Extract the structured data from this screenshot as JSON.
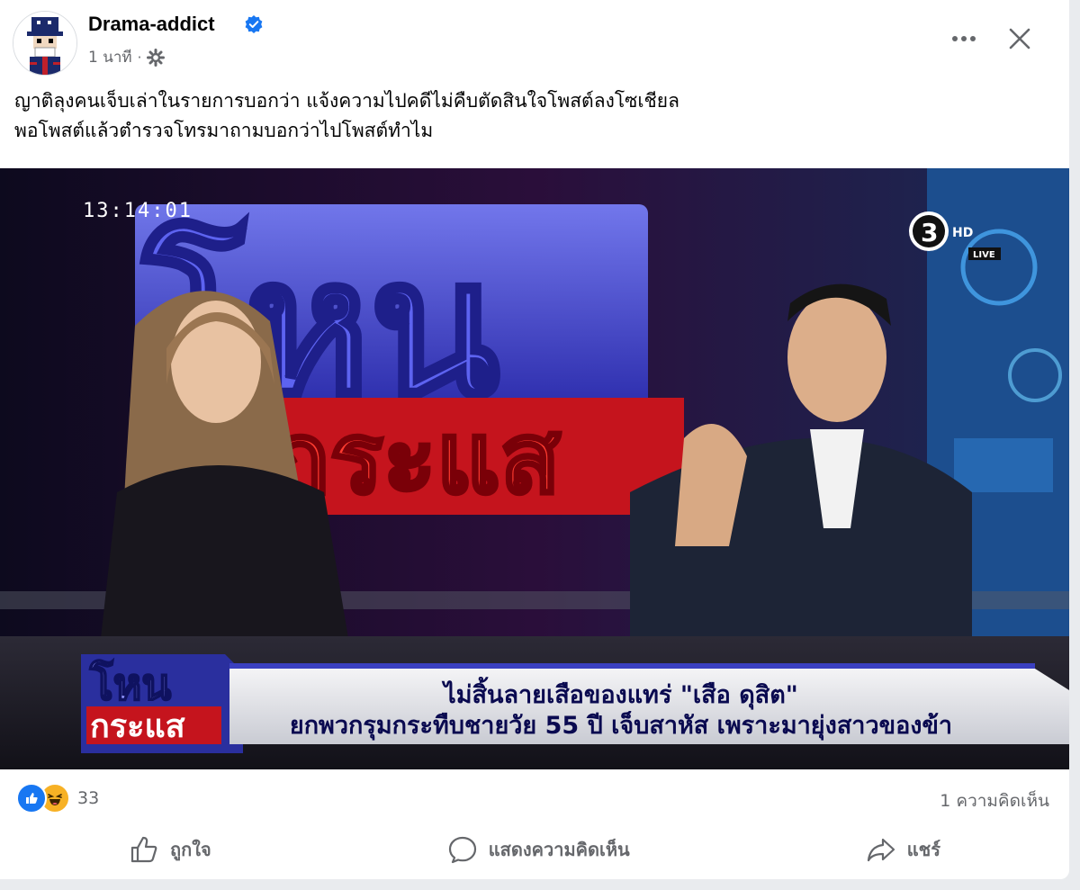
{
  "post": {
    "author": "Drama-addict",
    "time": "1 นาที",
    "caption_line1": "ญาติลุงคนเจ็บเล่าในรายการบอกว่า แจ้งความไปคดีไม่คืบตัดสินใจโพสต์ลงโซเชียล",
    "caption_line2": "พอโพสต์แล้วตำรวจโทรมาถามบอกว่าไปโพสต์ทำไม"
  },
  "media": {
    "timestamp": "13:14:01",
    "channel_number": "3",
    "channel_sub": "HD",
    "live_label": "LIVE",
    "show_logo_top": "โหน",
    "show_logo_bottom": "กระแส",
    "headline1": "ไม่สิ้นลายเสือของแทร่ \"เสือ ดุสิต\"",
    "headline2": "ยกพวกรุมกระทืบชายวัย 55 ปี เจ็บสาหัส เพราะมายุ่งสาวของข้า"
  },
  "stats": {
    "reaction_count": "33",
    "comment_count": "1 ความคิดเห็น"
  },
  "actions": {
    "like": "ถูกใจ",
    "comment": "แสดงความคิดเห็น",
    "share": "แชร์"
  },
  "icons": [
    "verified-badge-icon",
    "globe-icon",
    "more-options-icon",
    "close-icon",
    "like-reaction-icon",
    "haha-reaction-icon",
    "thumbs-up-icon",
    "comment-bubble-icon",
    "share-arrow-icon"
  ],
  "colors": {
    "accent": "#1877f2",
    "secondary_text": "#65676b",
    "haha": "#f7b125"
  }
}
